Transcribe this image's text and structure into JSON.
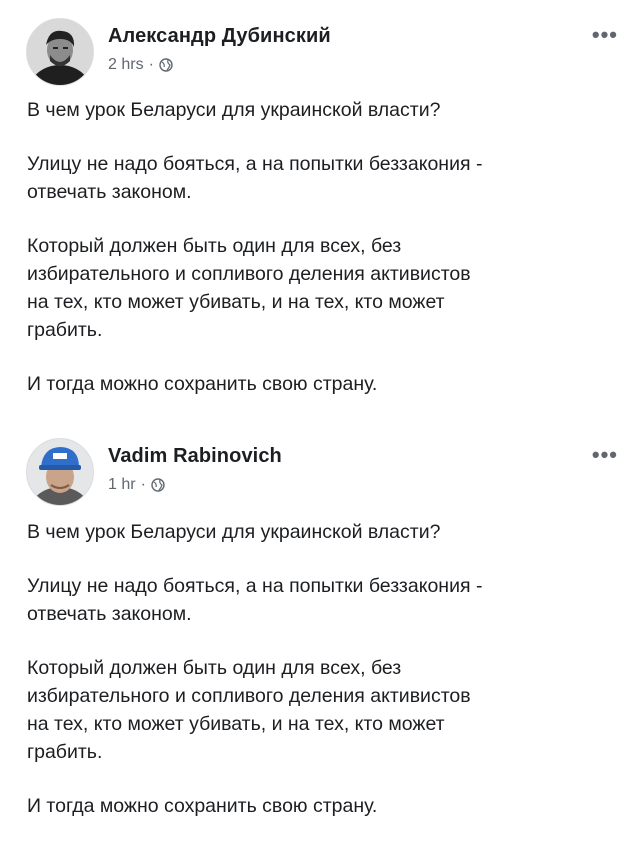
{
  "posts": [
    {
      "author": "Александр Дубинский",
      "time": "2 hrs",
      "separator": "·",
      "privacy_icon": "globe-icon",
      "more_icon": "more-options-icon",
      "more_glyph": "•••",
      "paragraphs": [
        [
          "В чем урок Беларуси для украинской власти?"
        ],
        [
          "Улицу не надо бояться, а на попытки беззакония -",
          "отвечать законом."
        ],
        [
          "Который должен быть один для всех, без",
          "избирательного и сопливого деления активистов",
          "на тех, кто может убивать, и на тех, кто может",
          "грабить."
        ],
        [
          "И тогда можно сохранить свою страну."
        ]
      ]
    },
    {
      "author": "Vadim Rabinovich",
      "time": "1 hr",
      "separator": "·",
      "privacy_icon": "globe-icon",
      "more_icon": "more-options-icon",
      "more_glyph": "•••",
      "paragraphs": [
        [
          "В чем урок Беларуси для украинской власти?"
        ],
        [
          "Улицу не надо бояться, а на попытки беззакония -",
          "отвечать законом."
        ],
        [
          "Который должен быть один для всех, без",
          "избирательного и сопливого деления активистов",
          "на тех, кто может убивать, и на тех, кто может",
          "грабить."
        ],
        [
          "И тогда можно сохранить свою страну."
        ]
      ]
    }
  ],
  "colors": {
    "text": "#1c1e21",
    "secondary": "#606770",
    "background": "#ffffff",
    "cap_blue": "#2f6fc9"
  }
}
